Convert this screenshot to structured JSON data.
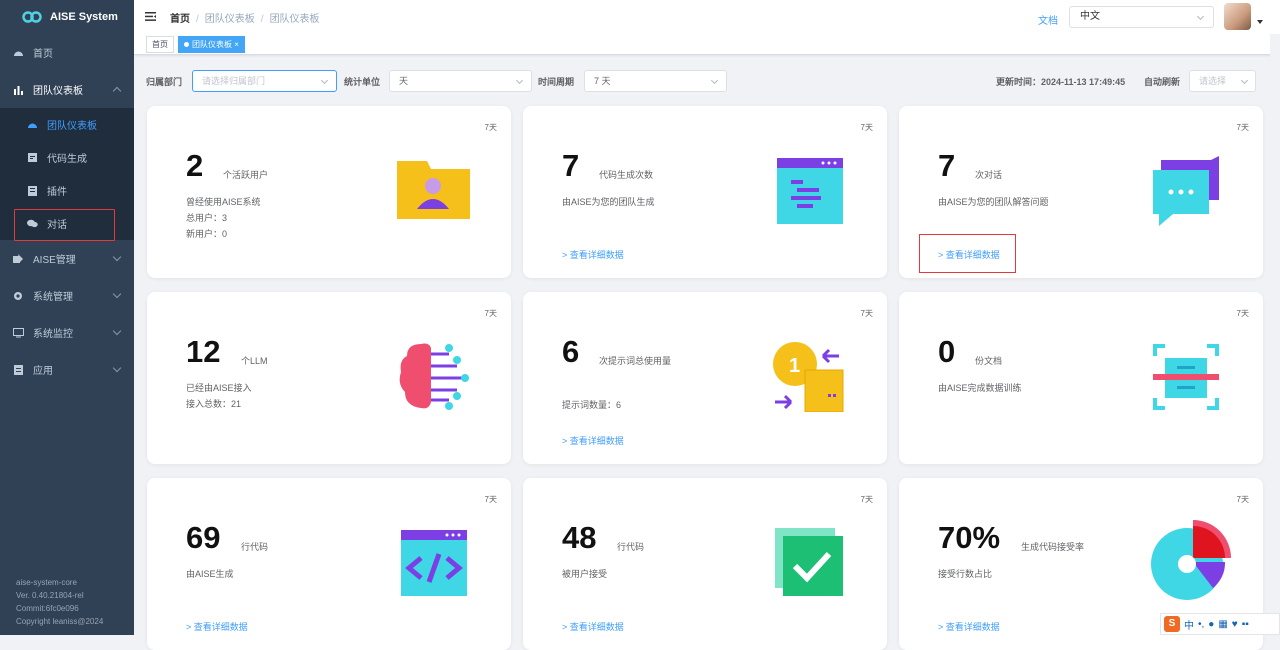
{
  "app": {
    "title": "AISE System"
  },
  "sidebar": {
    "items": [
      {
        "label": "首页"
      },
      {
        "label": "团队仪表板"
      },
      {
        "label": "AISE管理"
      },
      {
        "label": "系统管理"
      },
      {
        "label": "系统监控"
      },
      {
        "label": "应用"
      }
    ],
    "sub": [
      {
        "label": "团队仪表板"
      },
      {
        "label": "代码生成"
      },
      {
        "label": "插件"
      },
      {
        "label": "对话"
      }
    ],
    "footer": [
      "aise-system-core",
      "Ver. 0.40.21804-rel",
      "Commit:6fc0e096",
      "Copyright leaniss@2024"
    ]
  },
  "header": {
    "breadcrumb": [
      "首页",
      "团队仪表板",
      "团队仪表板"
    ],
    "doc_link": "文档",
    "language": "中文"
  },
  "tags": [
    "首页",
    "团队仪表板"
  ],
  "filters": {
    "dept_label": "归属部门",
    "dept_placeholder": "请选择归属部门",
    "unit_label": "统计单位",
    "unit_value": "天",
    "period_label": "时间周期",
    "period_value": "7 天",
    "updated_label": "更新时间：",
    "updated_value": "2024-11-13 17:49:45",
    "refresh_label": "自动刷新",
    "refresh_placeholder": "请选择"
  },
  "cards": [
    {
      "period": "7天",
      "value": "2",
      "unit": "个活跃用户",
      "desc": [
        "曾经使用AISE系统",
        "总用户：3",
        "新用户：0"
      ],
      "link": ""
    },
    {
      "period": "7天",
      "value": "7",
      "unit": "代码生成次数",
      "desc": [
        "由AISE为您的团队生成"
      ],
      "link": "> 查看详细数据"
    },
    {
      "period": "7天",
      "value": "7",
      "unit": "次对话",
      "desc": [
        "由AISE为您的团队解答问题"
      ],
      "link": "> 查看详细数据"
    },
    {
      "period": "7天",
      "value": "12",
      "unit": "个LLM",
      "desc": [
        "已经由AISE接入",
        "接入总数：21"
      ],
      "link": ""
    },
    {
      "period": "7天",
      "value": "6",
      "unit": "次提示词总使用量",
      "desc": [
        "提示词数量：6"
      ],
      "link": "> 查看详细数据"
    },
    {
      "period": "7天",
      "value": "0",
      "unit": "份文档",
      "desc": [
        "由AISE完成数据训练"
      ],
      "link": ""
    },
    {
      "period": "7天",
      "value": "69",
      "unit": "行代码",
      "desc": [
        "由AISE生成"
      ],
      "link": "> 查看详细数据"
    },
    {
      "period": "7天",
      "value": "48",
      "unit": "行代码",
      "desc": [
        "被用户接受"
      ],
      "link": "> 查看详细数据"
    },
    {
      "period": "7天",
      "value": "70%",
      "unit": "生成代码接受率",
      "desc": [
        "接受行数占比"
      ],
      "link": "> 查看详细数据"
    }
  ],
  "taskbar": {
    "ime": "中"
  }
}
